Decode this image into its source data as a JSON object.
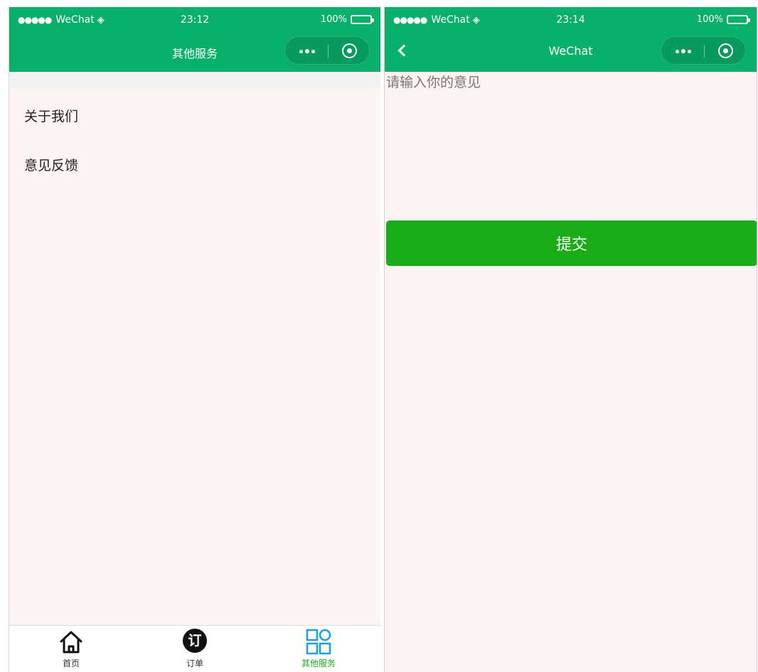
{
  "left_screen": {
    "status_bar": {
      "signal": "●●●●●",
      "carrier": "WeChat",
      "time": "23:12",
      "battery": "100%"
    },
    "nav_title": "其他服务",
    "menu": [
      {
        "label": "关于我们"
      },
      {
        "label": "意见反馈"
      }
    ],
    "tabbar": [
      {
        "label": "首页",
        "icon": "home-icon"
      },
      {
        "label": "订单",
        "icon": "order-icon",
        "icon_text": "订"
      },
      {
        "label": "其他服务",
        "icon": "grid-icon",
        "active": true
      }
    ]
  },
  "right_screen": {
    "status_bar": {
      "signal": "●●●●●",
      "carrier": "WeChat",
      "time": "23:14",
      "battery": "100%"
    },
    "nav_title": "WeChat",
    "feedback_input": {
      "placeholder": "请输入你的意见",
      "value": ""
    },
    "submit_label": "提交"
  },
  "colors": {
    "nav_green": "#08b06a",
    "button_green": "#1aad19",
    "page_background": "#fcf3f2",
    "active_tab": "#1aad19",
    "grid_icon": "#1a9fe0"
  }
}
